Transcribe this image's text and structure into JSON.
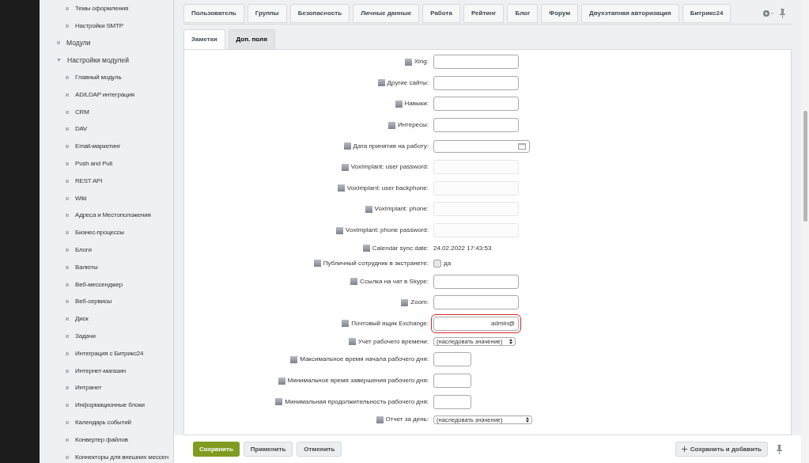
{
  "sidebar": {
    "leading_children": [
      {
        "label": "Темы оформления"
      },
      {
        "label": "Настройки SMTP"
      }
    ],
    "items": [
      {
        "label": "Модули",
        "expanded": false
      },
      {
        "label": "Настройки модулей",
        "expanded": true,
        "children": [
          {
            "label": "Главный модуль"
          },
          {
            "label": "AD/LDAP интеграция"
          },
          {
            "label": "CRM"
          },
          {
            "label": "DAV"
          },
          {
            "label": "Email-маркетинг"
          },
          {
            "label": "Push and Pull"
          },
          {
            "label": "REST API"
          },
          {
            "label": "Wiki"
          },
          {
            "label": "Адреса и Местоположения"
          },
          {
            "label": "Бизнес-процессы"
          },
          {
            "label": "Блоги"
          },
          {
            "label": "Валюты"
          },
          {
            "label": "Веб-мессенджер"
          },
          {
            "label": "Веб-сервисы"
          },
          {
            "label": "Диск"
          },
          {
            "label": "Задачи"
          },
          {
            "label": "Интеграция с Битрикс24"
          },
          {
            "label": "Интернет-магазин"
          },
          {
            "label": "Интранет"
          },
          {
            "label": "Информационные блоки"
          },
          {
            "label": "Календарь событий"
          },
          {
            "label": "Конвертер файлов"
          },
          {
            "label": "Коннекторы для внешних мессен"
          }
        ]
      }
    ]
  },
  "tabs": [
    {
      "label": "Пользователь",
      "selected": false
    },
    {
      "label": "Группы",
      "selected": false
    },
    {
      "label": "Безопасность",
      "selected": false
    },
    {
      "label": "Личные данные",
      "selected": false
    },
    {
      "label": "Работа",
      "selected": false
    },
    {
      "label": "Рейтинг",
      "selected": false
    },
    {
      "label": "Блог",
      "selected": false
    },
    {
      "label": "Форум",
      "selected": false
    },
    {
      "label": "Двухэтапная авторизация",
      "selected": false
    },
    {
      "label": "Битрикс24",
      "selected": false
    }
  ],
  "subtabs": [
    {
      "label": "Заметки",
      "selected": false
    },
    {
      "label": "Доп. поля",
      "selected": true
    }
  ],
  "fields": [
    {
      "kind": "input",
      "label": "Xing:",
      "disabled": false
    },
    {
      "kind": "input",
      "label": "Другие сайты:",
      "disabled": false
    },
    {
      "kind": "input",
      "label": "Навыки:",
      "disabled": false
    },
    {
      "kind": "input",
      "label": "Интересы:",
      "disabled": false
    },
    {
      "kind": "date",
      "label": "Дата принятия на работу:",
      "disabled": false
    },
    {
      "kind": "input",
      "label": "VoxImplant: user password:",
      "disabled": true
    },
    {
      "kind": "input",
      "label": "VoxImplant: user backphone:",
      "disabled": true
    },
    {
      "kind": "input",
      "label": "VoxImplant: phone:",
      "disabled": true
    },
    {
      "kind": "input",
      "label": "VoxImplant: phone password:",
      "disabled": true
    },
    {
      "kind": "text",
      "label": "Calendar sync date:",
      "value": "24.02.2022 17:43:53"
    },
    {
      "kind": "checkbox",
      "label": "Публичный сотрудник в экстранете:",
      "option": "да",
      "checked": false
    },
    {
      "kind": "input",
      "label": "Ссылка на чат в Skype:",
      "disabled": false
    },
    {
      "kind": "input",
      "label": "Zoom:",
      "disabled": false
    },
    {
      "kind": "input",
      "label": "Почтовый ящик Exchange:",
      "value": "admin@",
      "disabled": false,
      "highlighted": true
    },
    {
      "kind": "select",
      "label": "Учет рабочего времени:",
      "value": "(наследовать значение)",
      "wide": false
    },
    {
      "kind": "short",
      "label": "Максимальное время начала рабочего дня:"
    },
    {
      "kind": "short",
      "label": "Минимальное время завершения рабочего дня:"
    },
    {
      "kind": "short",
      "label": "Минимальная продолжительность рабочего дня:"
    },
    {
      "kind": "select",
      "label": "Отчет за день:",
      "value": "(наследовать значение)",
      "wide": true
    }
  ],
  "footer": {
    "buttons": [
      {
        "label": "Сохранить",
        "primary": true
      },
      {
        "label": "Применить",
        "primary": false
      },
      {
        "label": "Отменить",
        "primary": false
      }
    ],
    "save_add": "Сохранить и добавить"
  }
}
